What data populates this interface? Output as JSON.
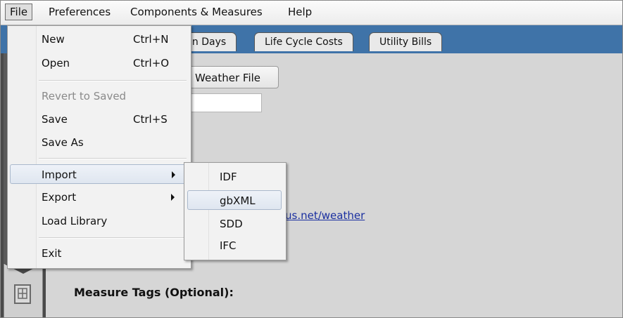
{
  "menubar": {
    "items": [
      {
        "label": "File"
      },
      {
        "label": "Preferences"
      },
      {
        "label": "Components & Measures"
      },
      {
        "label": "Help"
      }
    ]
  },
  "tabs": [
    {
      "label": "gn Days"
    },
    {
      "label": "Life Cycle Costs"
    },
    {
      "label": "Utility Bills"
    }
  ],
  "main": {
    "weather_button_label": "Weather File",
    "text_field_value": "",
    "link_text": "us.net/weather",
    "measure_tags_label": "Measure Tags (Optional):"
  },
  "file_menu": {
    "items": [
      {
        "label": "New",
        "shortcut": "Ctrl+N"
      },
      {
        "label": "Open",
        "shortcut": "Ctrl+O"
      },
      {
        "label": "Revert to Saved",
        "disabled": true
      },
      {
        "label": "Save",
        "shortcut": "Ctrl+S"
      },
      {
        "label": "Save As"
      },
      {
        "label": "Import",
        "submenu": true
      },
      {
        "label": "Export",
        "submenu": true
      },
      {
        "label": "Load Library"
      },
      {
        "label": "Exit"
      }
    ]
  },
  "import_menu": {
    "items": [
      {
        "label": "IDF"
      },
      {
        "label": "gbXML"
      },
      {
        "label": "SDD"
      },
      {
        "label": "IFC"
      }
    ],
    "highlighted": "gbXML"
  },
  "colors": {
    "tab_strip": "#3f73a8",
    "menu_highlight_border": "#a9b8cc",
    "link": "#1a2fa0"
  },
  "icons": {
    "submenu_arrow": "triangle-right",
    "side_button": "measure-icon"
  }
}
